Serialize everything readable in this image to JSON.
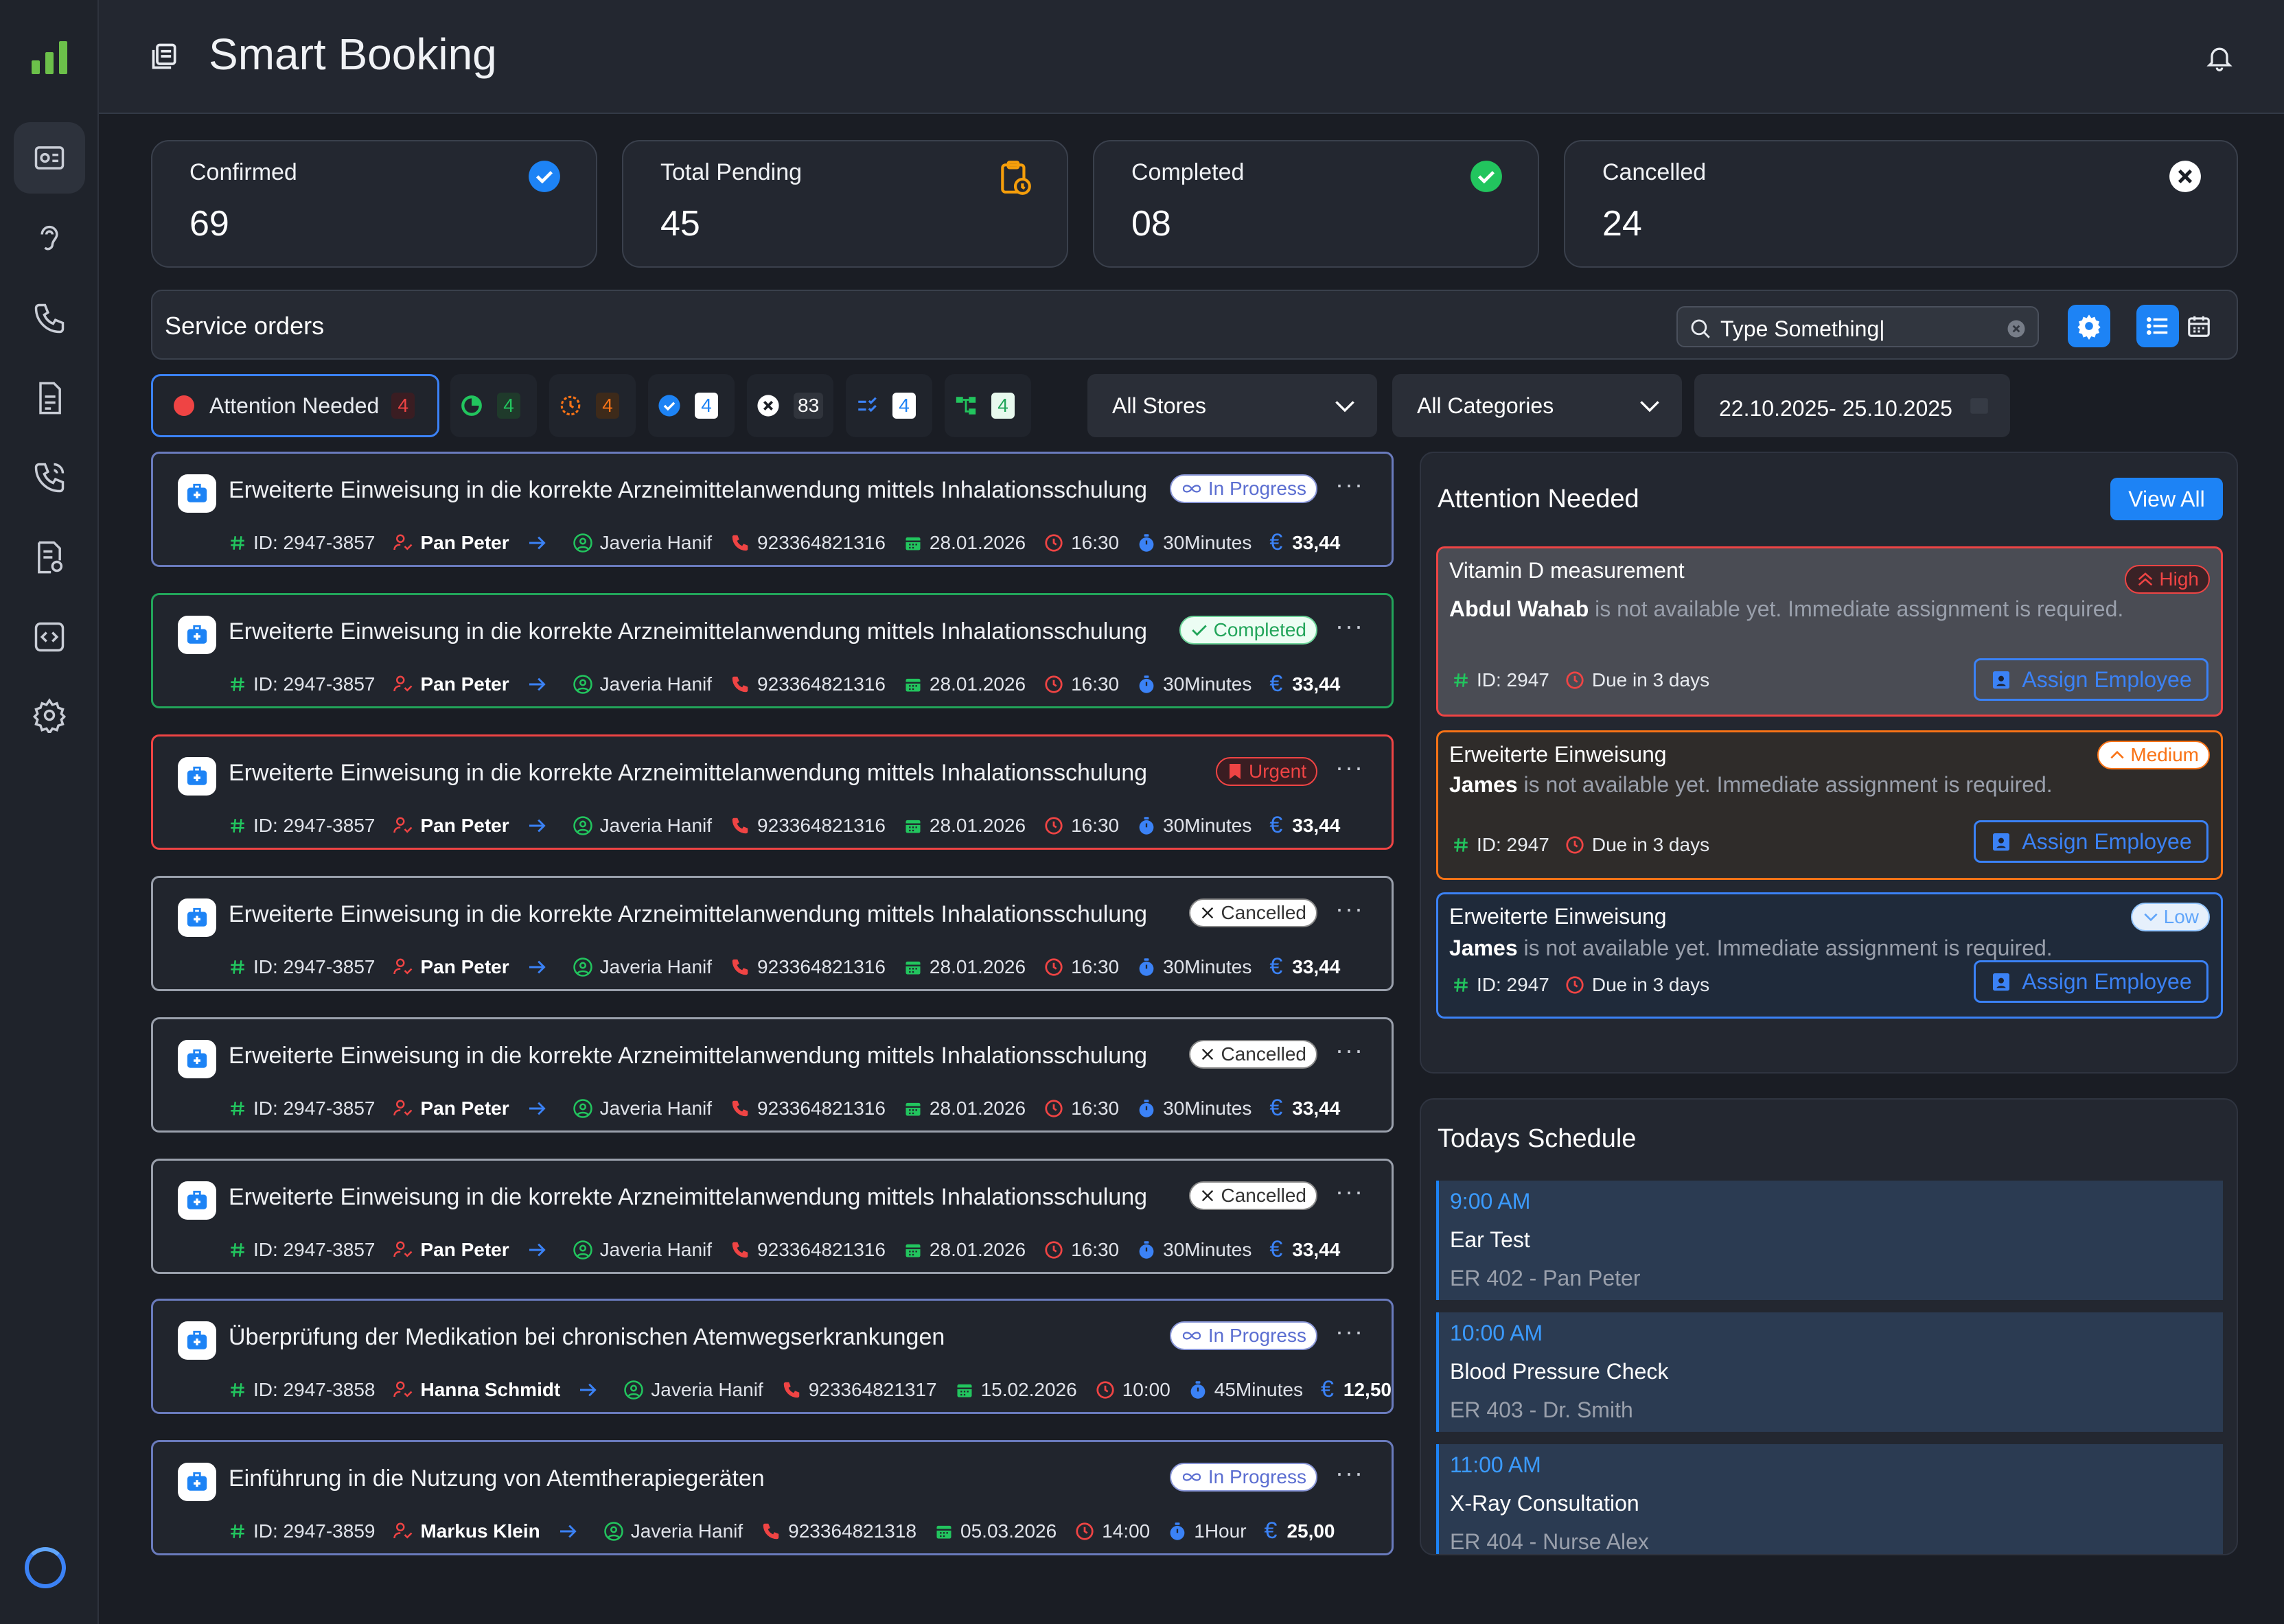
{
  "app": {
    "title": "Smart Booking"
  },
  "stats": [
    {
      "label": "Confirmed",
      "value": "69",
      "icon": "check-circle-blue-icon"
    },
    {
      "label": "Total Pending",
      "value": "45",
      "icon": "clipboard-clock-icon"
    },
    {
      "label": "Completed",
      "value": "08",
      "icon": "check-circle-green-icon"
    },
    {
      "label": "Cancelled",
      "value": "24",
      "icon": "x-circle-icon"
    }
  ],
  "service": {
    "title": "Service orders",
    "search_value": "Type Something|"
  },
  "filters": {
    "attention_label": "Attention Needed",
    "attention_count": "4",
    "counts": [
      "4",
      "4",
      "4",
      "83",
      "4",
      "4"
    ],
    "stores": "All Stores",
    "categories": "All Categories",
    "dates": "22.10.2025- 25.10.2025"
  },
  "orders": [
    {
      "title": "Erweiterte Einweisung in die korrekte Arzneimittelanwendung mittels Inhalationsschulung",
      "status": "In Progress",
      "id": "ID: 2947-3857",
      "client": "Pan Peter",
      "employee": "Javeria Hanif",
      "phone": "923364821316",
      "date": "28.01.2026",
      "time": "16:30",
      "duration": "30Minutes",
      "price": "33,44"
    },
    {
      "title": "Erweiterte Einweisung in die korrekte Arzneimittelanwendung mittels Inhalationsschulung",
      "status": "Completed",
      "id": "ID: 2947-3857",
      "client": "Pan Peter",
      "employee": "Javeria Hanif",
      "phone": "923364821316",
      "date": "28.01.2026",
      "time": "16:30",
      "duration": "30Minutes",
      "price": "33,44"
    },
    {
      "title": "Erweiterte Einweisung in die korrekte Arzneimittelanwendung mittels Inhalationsschulung",
      "status": "Urgent",
      "id": "ID: 2947-3857",
      "client": "Pan Peter",
      "employee": "Javeria Hanif",
      "phone": "923364821316",
      "date": "28.01.2026",
      "time": "16:30",
      "duration": "30Minutes",
      "price": "33,44"
    },
    {
      "title": "Erweiterte Einweisung in die korrekte Arzneimittelanwendung mittels Inhalationsschulung",
      "status": "Cancelled",
      "id": "ID: 2947-3857",
      "client": "Pan Peter",
      "employee": "Javeria Hanif",
      "phone": "923364821316",
      "date": "28.01.2026",
      "time": "16:30",
      "duration": "30Minutes",
      "price": "33,44"
    },
    {
      "title": "Erweiterte Einweisung in die korrekte Arzneimittelanwendung mittels Inhalationsschulung",
      "status": "Cancelled",
      "id": "ID: 2947-3857",
      "client": "Pan Peter",
      "employee": "Javeria Hanif",
      "phone": "923364821316",
      "date": "28.01.2026",
      "time": "16:30",
      "duration": "30Minutes",
      "price": "33,44"
    },
    {
      "title": "Erweiterte Einweisung in die korrekte Arzneimittelanwendung mittels Inhalationsschulung",
      "status": "Cancelled",
      "id": "ID: 2947-3857",
      "client": "Pan Peter",
      "employee": "Javeria Hanif",
      "phone": "923364821316",
      "date": "28.01.2026",
      "time": "16:30",
      "duration": "30Minutes",
      "price": "33,44"
    },
    {
      "title": "Überprüfung der Medikation bei chronischen Atemwegserkrankungen",
      "status": "In Progress",
      "id": "ID: 2947-3858",
      "client": "Hanna Schmidt",
      "employee": "Javeria Hanif",
      "phone": "923364821317",
      "date": "15.02.2026",
      "time": "10:00",
      "duration": "45Minutes",
      "price": "12,50"
    },
    {
      "title": "Einführung in die Nutzung von Atemtherapiegeräten",
      "status": "In Progress",
      "id": "ID: 2947-3859",
      "client": "Markus Klein",
      "employee": "Javeria Hanif",
      "phone": "923364821318",
      "date": "05.03.2026",
      "time": "14:00",
      "duration": "1Hour",
      "price": "25,00"
    }
  ],
  "attention": {
    "title": "Attention Needed",
    "view_all": "View All",
    "items": [
      {
        "title": "Vitamin D measurement",
        "priority": "High",
        "name": "Abdul Wahab",
        "message": " is not available yet. Immediate assignment is required.",
        "id": "ID: 2947",
        "due": "Due in 3 days",
        "action": "Assign Employee"
      },
      {
        "title": "Erweiterte Einweisung",
        "priority": "Medium",
        "name": "James",
        "message": " is not available yet. Immediate assignment is required.",
        "id": "ID: 2947",
        "due": "Due in 3 days",
        "action": "Assign Employee"
      },
      {
        "title": "Erweiterte Einweisung",
        "priority": "Low",
        "name": "James",
        "message": " is not available yet. Immediate assignment is required.",
        "id": "ID: 2947",
        "due": "Due in 3 days",
        "action": "Assign Employee"
      }
    ]
  },
  "schedule": {
    "title": "Todays Schedule",
    "items": [
      {
        "time": "9:00 AM",
        "name": "Ear Test",
        "room": "ER 402 - Pan Peter"
      },
      {
        "time": "10:00 AM",
        "name": "Blood Pressure Check",
        "room": "ER 403 - Dr. Smith"
      },
      {
        "time": "11:00 AM",
        "name": "X-Ray Consultation",
        "room": "ER 404 - Nurse Alex"
      }
    ]
  },
  "colors": {
    "accent": "#1d83f5",
    "in_progress": "#5b6ed1",
    "completed": "#22a55a",
    "urgent": "#ef4444",
    "cancelled": "#888888",
    "medium": "#f97316",
    "low": "#3b82f6"
  }
}
